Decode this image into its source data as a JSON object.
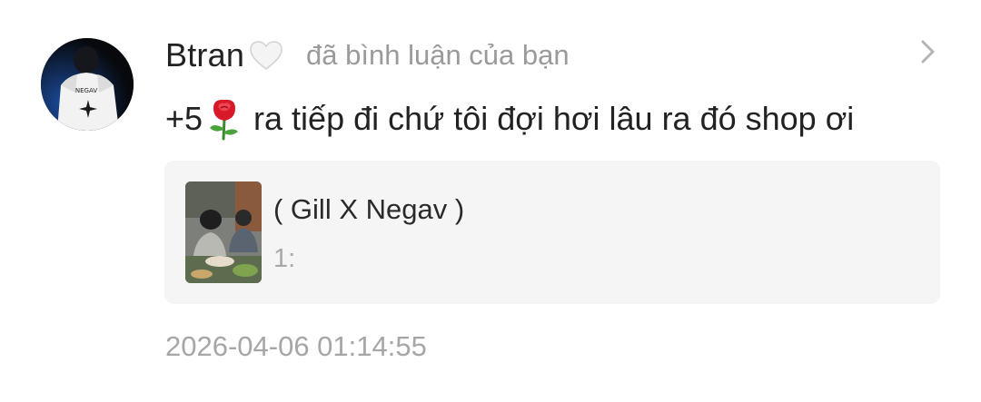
{
  "notification": {
    "user": {
      "name": "Btran",
      "heart_icon": "white-heart-icon"
    },
    "action": "đã bình luận của bạn",
    "comment": {
      "prefix": "+5",
      "emoji_icon": "rose-icon",
      "text": "ra tiếp đi chứ tôi đợi hơi lâu ra đó shop ơi"
    },
    "post": {
      "title": "( Gill X Negav )",
      "subtitle": "1:"
    },
    "timestamp": "2026-04-06 01:14:55"
  }
}
